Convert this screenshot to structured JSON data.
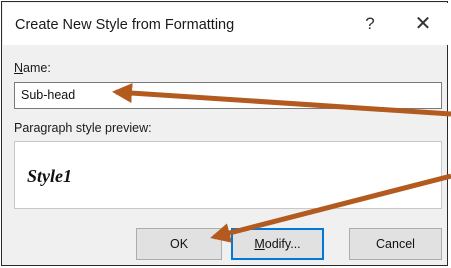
{
  "dialog": {
    "title": "Create New Style from Formatting",
    "help_glyph": "?",
    "close_glyph": "✕"
  },
  "name_field": {
    "label_accel": "N",
    "label_rest": "ame:",
    "value": "Sub-head"
  },
  "preview": {
    "label": "Paragraph style preview:",
    "text": "Style1"
  },
  "buttons": {
    "ok": "OK",
    "modify_accel": "M",
    "modify_rest": "odify...",
    "cancel": "Cancel"
  },
  "colors": {
    "arrow": "#b35a1f",
    "default_button_border": "#0078d7"
  }
}
